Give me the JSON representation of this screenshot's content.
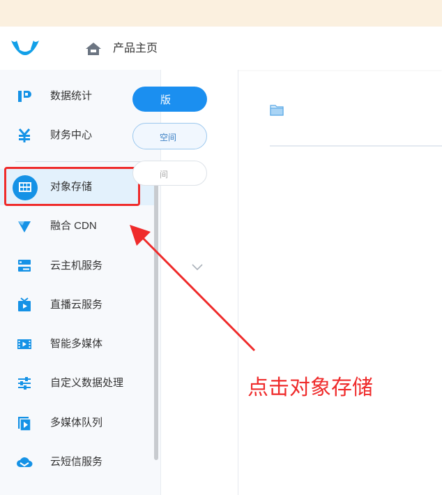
{
  "header": {
    "title": "产品主页"
  },
  "sidebar": {
    "items": [
      {
        "label": "数据统计",
        "icon": "chart-icon"
      },
      {
        "label": "财务中心",
        "icon": "yen-icon"
      },
      {
        "label": "对象存储",
        "icon": "storage-grid-icon",
        "active": true
      },
      {
        "label": "融合 CDN",
        "icon": "cdn-icon"
      },
      {
        "label": "云主机服务",
        "icon": "server-icon"
      },
      {
        "label": "直播云服务",
        "icon": "live-tv-icon"
      },
      {
        "label": "智能多媒体",
        "icon": "film-icon"
      },
      {
        "label": "自定义数据处理",
        "icon": "sliders-icon"
      },
      {
        "label": "多媒体队列",
        "icon": "media-queue-icon"
      },
      {
        "label": "云短信服务",
        "icon": "cloud-message-icon"
      }
    ]
  },
  "mid": {
    "pill_primary": "版",
    "pill_secondary": "空间",
    "pill_tertiary": "间"
  },
  "annotation": {
    "text": "点击对象存储"
  },
  "colors": {
    "accent": "#1b8ff0",
    "annotation": "#ef2b2b",
    "banner": "#fbf0df"
  }
}
